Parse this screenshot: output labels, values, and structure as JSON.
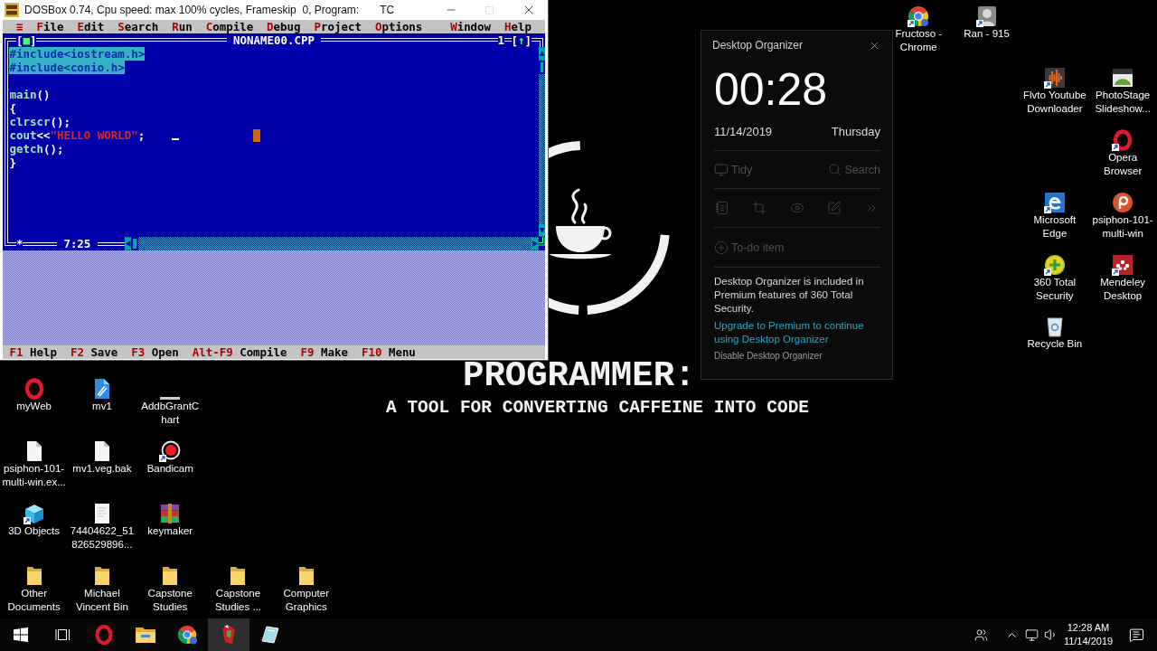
{
  "dosbox": {
    "title": "DOSBox 0.74, Cpu speed: max 100% cycles, Frameskip  0, Program:       TC",
    "window_controls": [
      {
        "kind": "minimize",
        "disabled": false
      },
      {
        "kind": "maximize",
        "disabled": true
      },
      {
        "kind": "close",
        "disabled": false
      }
    ],
    "menu": [
      "≡",
      "File",
      "Edit",
      "Search",
      "Run",
      "Compile",
      "Debug",
      "Project",
      "Options"
    ],
    "menu_right": [
      "Window",
      "Help"
    ],
    "editor": {
      "close_box": "[■]",
      "title": "NONAME00.CPP",
      "window_number": "1",
      "zoom_box": "[↑]",
      "lines": [
        {
          "selected": true,
          "tokens": [
            {
              "kind": "preprocessor",
              "text": "#include<iostream.h>"
            }
          ]
        },
        {
          "selected": true,
          "tokens": [
            {
              "kind": "preprocessor",
              "text": "#include<conio.h>"
            }
          ]
        },
        {
          "selected": false
        },
        {
          "selected": false,
          "tokens": [
            {
              "kind": "ident",
              "text": "main"
            },
            {
              "kind": "symbol",
              "text": "()"
            }
          ]
        },
        {
          "selected": false,
          "tokens": [
            {
              "kind": "symbol",
              "text": "{"
            }
          ]
        },
        {
          "selected": false,
          "tokens": [
            {
              "kind": "ident",
              "text": "clrscr"
            },
            {
              "kind": "symbol",
              "text": "();"
            }
          ]
        },
        {
          "selected": false,
          "tokens": [
            {
              "kind": "ident",
              "text": "cout"
            },
            {
              "kind": "symbol",
              "text": "<<"
            },
            {
              "kind": "string",
              "text": "\"HELLO WORLD\""
            },
            {
              "kind": "symbol",
              "text": ";"
            }
          ]
        },
        {
          "selected": false,
          "tokens": [
            {
              "kind": "ident",
              "text": "getch"
            },
            {
              "kind": "symbol",
              "text": "();"
            }
          ]
        },
        {
          "selected": false,
          "tokens": [
            {
              "kind": "symbol",
              "text": "}"
            }
          ]
        }
      ],
      "modified_mark": "*",
      "position": "7:25"
    },
    "status_bar": [
      {
        "key": "F1",
        "label": "Help"
      },
      {
        "key": "F2",
        "label": "Save"
      },
      {
        "key": "F3",
        "label": "Open"
      },
      {
        "key": "Alt-F9",
        "label": "Compile"
      },
      {
        "key": "F9",
        "label": "Make"
      },
      {
        "key": "F10",
        "label": "Menu"
      }
    ]
  },
  "wallpaper": {
    "headline": "PROGRAMMER:",
    "tagline": "A TOOL FOR CONVERTING CAFFEINE INTO CODE"
  },
  "organizer": {
    "title": "Desktop Organizer",
    "time": "00:28",
    "date": "11/14/2019",
    "weekday": "Thursday",
    "tools": [
      {
        "kind": "tidy",
        "label": "Tidy",
        "disabled": true
      },
      {
        "kind": "search",
        "label": "Search",
        "disabled": true
      }
    ],
    "shortcuts": [
      {
        "kind": "notebook",
        "disabled": true
      },
      {
        "kind": "crop",
        "disabled": true
      },
      {
        "kind": "eye",
        "disabled": true
      },
      {
        "kind": "edit",
        "disabled": true
      },
      {
        "kind": "more",
        "disabled": true
      }
    ],
    "todo": {
      "label": "To-do item",
      "disabled": true
    },
    "notice": "Desktop Organizer is included in Premium features of 360 Total Security.",
    "upgrade_link": "Upgrade to Premium to continue using Desktop Organizer",
    "disable_link": "Disable Desktop Organizer"
  },
  "desktop_icons": [
    {
      "kind": "chrome",
      "label_lines": [
        "Fructoso -",
        "Chrome"
      ],
      "shortcut": true
    },
    {
      "kind": "avatar",
      "label_lines": [
        "Ran - 915"
      ],
      "shortcut": true
    },
    {
      "kind": "waveform",
      "label_lines": [
        "Flvto Youtube",
        "Downloader"
      ],
      "shortcut": true
    },
    {
      "kind": "picture",
      "label_lines": [
        "PhotoStage",
        "Slideshow..."
      ],
      "shortcut": false
    },
    {
      "kind": "opera",
      "label_lines": [
        "Opera",
        "Browser"
      ],
      "shortcut": true
    },
    {
      "kind": "edge",
      "label_lines": [
        "Microsoft",
        "Edge"
      ],
      "shortcut": true
    },
    {
      "kind": "psiphon",
      "label_lines": [
        "psiphon-101-",
        "multi-win"
      ],
      "shortcut": false
    },
    {
      "kind": "plus",
      "label_lines": [
        "360 Total",
        "Security"
      ],
      "shortcut": true
    },
    {
      "kind": "mendeley",
      "label_lines": [
        "Mendeley",
        "Desktop"
      ],
      "shortcut": true
    },
    {
      "kind": "recycle",
      "label_lines": [
        "Recycle Bin"
      ],
      "shortcut": false
    },
    {
      "kind": "opera",
      "label_lines": [
        "myWeb"
      ],
      "shortcut": false
    },
    {
      "kind": "media",
      "label_lines": [
        "mv1"
      ],
      "shortcut": false
    },
    {
      "kind": "bar",
      "label_lines": [
        "AddbGrantC",
        "hart"
      ],
      "shortcut": false
    },
    {
      "kind": "file",
      "label_lines": [
        "psiphon-101-",
        "multi-win.ex..."
      ],
      "shortcut": false
    },
    {
      "kind": "file",
      "label_lines": [
        "mv1.veg.bak"
      ],
      "shortcut": false
    },
    {
      "kind": "bandicam",
      "label_lines": [
        "Bandicam"
      ],
      "shortcut": true
    },
    {
      "kind": "cube",
      "label_lines": [
        "3D Objects"
      ],
      "shortcut": true
    },
    {
      "kind": "document",
      "label_lines": [
        "74404622_51",
        "826529896..."
      ],
      "shortcut": false
    },
    {
      "kind": "archive",
      "label_lines": [
        "keymaker"
      ],
      "shortcut": false
    },
    {
      "kind": "folder",
      "label_lines": [
        "Other",
        "Documents"
      ],
      "shortcut": false
    },
    {
      "kind": "folder",
      "label_lines": [
        "Michael",
        "Vincent Bin"
      ],
      "shortcut": false
    },
    {
      "kind": "folder",
      "label_lines": [
        "Capstone",
        "Studies"
      ],
      "shortcut": false
    },
    {
      "kind": "folder",
      "label_lines": [
        "Capstone",
        "Studies ..."
      ],
      "shortcut": false
    },
    {
      "kind": "folder",
      "label_lines": [
        "Computer",
        "Graphics"
      ],
      "shortcut": false
    }
  ],
  "taskbar": {
    "apps": [
      {
        "kind": "start",
        "selected": false
      },
      {
        "kind": "task_view",
        "selected": false
      },
      {
        "kind": "opera",
        "selected": false
      },
      {
        "kind": "explorer",
        "selected": false
      },
      {
        "kind": "chrome",
        "selected": false
      },
      {
        "kind": "dosbox",
        "selected": true
      },
      {
        "kind": "glass",
        "selected": false
      }
    ],
    "time": "12:28 AM",
    "date": "11/14/2019"
  }
}
